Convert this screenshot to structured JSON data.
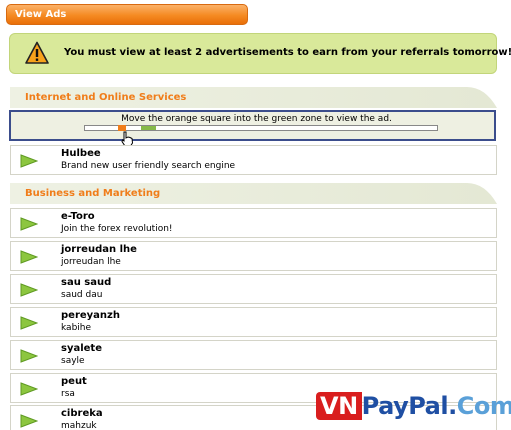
{
  "header": {
    "title": "View Ads"
  },
  "warning": {
    "message": "You must view at least 2 advertisements to earn from your referrals tomorrow!"
  },
  "categories": [
    {
      "label": "Internet and Online Services"
    },
    {
      "label": "Business and Marketing"
    }
  ],
  "verification": {
    "instruction": "Move the orange square into the green zone to view the ad.",
    "handle_position_fraction": 0.095,
    "zone_position_fraction": 0.16
  },
  "ads_internet": [
    {
      "name": "Hulbee",
      "description": "Brand new user friendly search engine"
    }
  ],
  "ads_business": [
    {
      "name": "e-Toro",
      "description": "Join the forex revolution!"
    },
    {
      "name": "jorreudan lhe",
      "description": "jorreudan lhe"
    },
    {
      "name": "sau saud",
      "description": "saud dau"
    },
    {
      "name": "pereyanzh",
      "description": "kabihe"
    },
    {
      "name": "syalete",
      "description": "sayle"
    },
    {
      "name": "peut",
      "description": "rsa"
    },
    {
      "name": "cibreka",
      "description": "mahzuk"
    }
  ],
  "watermark": {
    "vn": "VN",
    "paypal": "PayPal",
    "dot": ".",
    "com": "Com"
  },
  "colors": {
    "accent_orange": "#f07d1a",
    "green_zone": "#86b94a",
    "warning_bg": "#d9e99a"
  },
  "icons": {
    "warning": "warning-triangle-icon",
    "ad": "green-arrow-icon",
    "cursor": "hand-pointer-icon"
  }
}
